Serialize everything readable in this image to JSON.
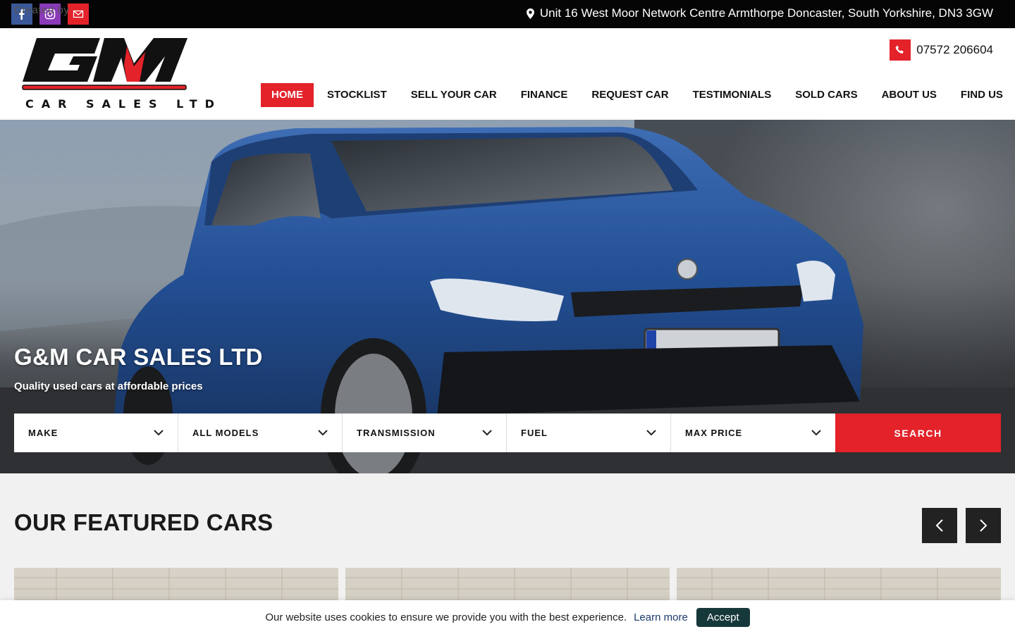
{
  "topbar": {
    "created_by": "Created by",
    "address": "Unit 16 West Moor Network Centre Armthorpe Doncaster, South Yorkshire, DN3 3GW",
    "social": [
      "facebook-icon",
      "instagram-icon",
      "mail-icon"
    ]
  },
  "header": {
    "logo_text": "GM",
    "logo_tagline": "CAR SALES LTD",
    "phone": "07572 206604",
    "nav": [
      "HOME",
      "STOCKLIST",
      "SELL YOUR CAR",
      "FINANCE",
      "REQUEST CAR",
      "TESTIMONIALS",
      "SOLD CARS",
      "ABOUT US",
      "FIND US"
    ],
    "active_nav": "HOME"
  },
  "hero": {
    "title": "G&M CAR SALES LTD",
    "subtitle": "Quality used cars at affordable prices",
    "filters": [
      "MAKE",
      "ALL MODELS",
      "TRANSMISSION",
      "FUEL",
      "MAX PRICE"
    ],
    "search_label": "SEARCH"
  },
  "featured": {
    "title": "OUR FEATURED CARS"
  },
  "cookie": {
    "text": "Our website uses cookies to ensure we provide you with the best experience.",
    "link": "Learn more",
    "accept": "Accept"
  },
  "colors": {
    "accent": "#e3222a",
    "topbar": "#050505",
    "dark_button": "#222222"
  }
}
